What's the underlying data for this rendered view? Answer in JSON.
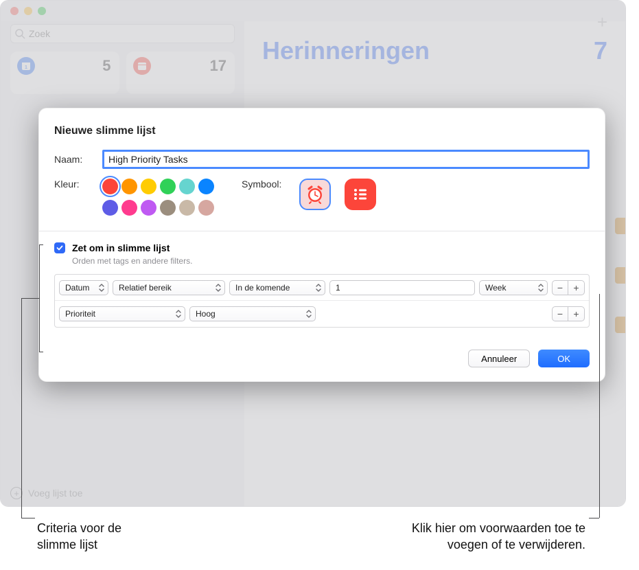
{
  "app": {
    "search_placeholder": "Zoek",
    "card_today": "5",
    "card_scheduled": "17",
    "add_list": "Voeg lijst toe"
  },
  "main": {
    "title": "Herinneringen",
    "count": "7"
  },
  "dialog": {
    "title": "Nieuwe slimme lijst",
    "name_label": "Naam:",
    "name_value": "High Priority Tasks",
    "color_label": "Kleur:",
    "symbol_label": "Symbool:",
    "smart_checkbox": "Zet om in slimme lijst",
    "smart_sub": "Orden met tags en andere filters.",
    "rules": {
      "r1": {
        "field": "Datum",
        "range_type": "Relatief bereik",
        "direction": "In de komende",
        "amount": "1",
        "unit": "Week"
      },
      "r2": {
        "field": "Prioriteit",
        "value": "Hoog"
      }
    },
    "cancel": "Annuleer",
    "ok": "OK"
  },
  "colors": {
    "row1": [
      "#fc453a",
      "#ff9500",
      "#ffcc02",
      "#30d158",
      "#66d4cf",
      "#0a84ff"
    ],
    "row2": [
      "#5e5ce6",
      "#ff3b8e",
      "#bf5af2",
      "#9b8e7e",
      "#c9b9a7",
      "#d6a7a0"
    ]
  },
  "callouts": {
    "left_line1": "Criteria voor de",
    "left_line2": "slimme lijst",
    "right_line1": "Klik hier om voorwaarden toe te",
    "right_line2": "voegen of te verwijderen."
  }
}
